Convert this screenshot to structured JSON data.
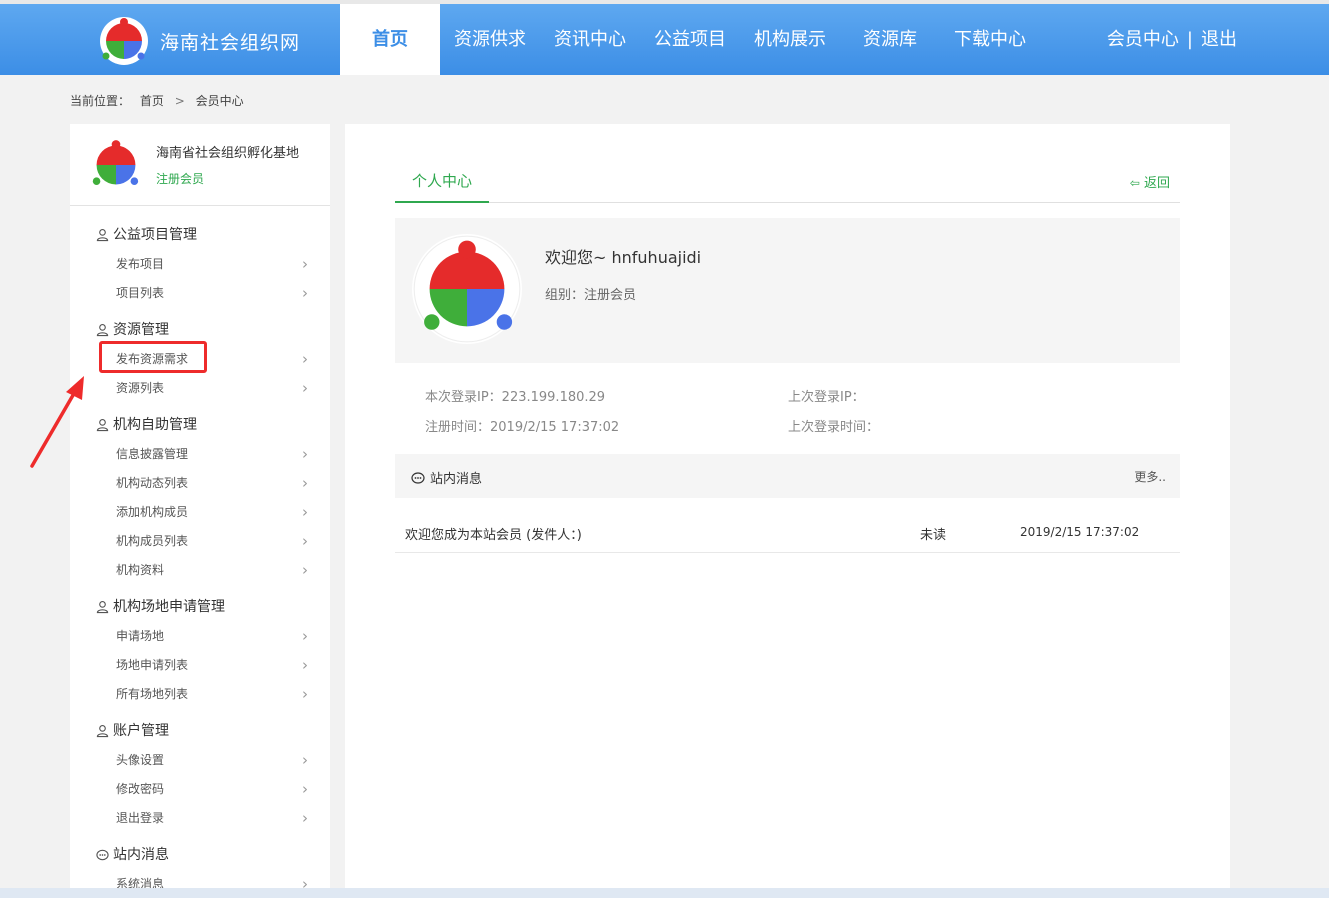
{
  "header": {
    "site_name": "海南社会组织网",
    "nav": [
      {
        "label": "首页",
        "active": true
      },
      {
        "label": "资源供求"
      },
      {
        "label": "资讯中心"
      },
      {
        "label": "公益项目"
      },
      {
        "label": "机构展示"
      },
      {
        "label": "资源库"
      },
      {
        "label": "下载中心"
      }
    ],
    "member_center": "会员中心",
    "separator": "|",
    "logout": "退出"
  },
  "breadcrumb": {
    "prefix": "当前位置：",
    "home": "首页",
    "arrow": ">",
    "current": "会员中心"
  },
  "sidebar": {
    "org_name": "海南省社会组织孵化基地",
    "org_level": "注册会员",
    "groups": [
      {
        "title": "公益项目管理",
        "icon": "user-icon",
        "items": [
          "发布项目",
          "项目列表"
        ]
      },
      {
        "title": "资源管理",
        "icon": "user-icon",
        "items": [
          "发布资源需求",
          "资源列表"
        ]
      },
      {
        "title": "机构自助管理",
        "icon": "user-icon",
        "items": [
          "信息披露管理",
          "机构动态列表",
          "添加机构成员",
          "机构成员列表",
          "机构资料"
        ]
      },
      {
        "title": "机构场地申请管理",
        "icon": "user-icon",
        "items": [
          "申请场地",
          "场地申请列表",
          "所有场地列表"
        ]
      },
      {
        "title": "账户管理",
        "icon": "user-icon",
        "items": [
          "头像设置",
          "修改密码",
          "退出登录"
        ]
      },
      {
        "title": "站内消息",
        "icon": "chat-icon",
        "items": [
          "系统消息"
        ]
      }
    ]
  },
  "main": {
    "tab": "个人中心",
    "back": "返回",
    "welcome": "欢迎您~ hnfuhuajidi",
    "group": "组别：注册会员",
    "login_ip": "本次登录IP：223.199.180.29",
    "last_login_ip": "上次登录IP：",
    "register_time": "注册时间：2019/2/15 17:37:02",
    "last_login_time": "上次登录时间：",
    "messages_title": "站内消息",
    "more": "更多..",
    "messages": [
      {
        "content": "欢迎您成为本站会员 (发件人：)",
        "status": "未读",
        "time": "2019/2/15 17:37:02"
      }
    ]
  },
  "colors": {
    "nav_blue": "#3c8ee6",
    "accent_green": "#2fa84f",
    "annotation_red": "#ee2b2b"
  }
}
